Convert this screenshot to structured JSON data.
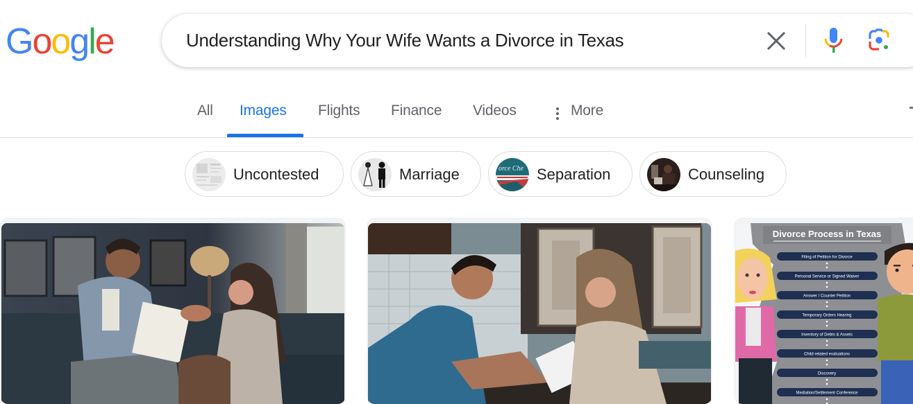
{
  "logo": {
    "text": "Google",
    "letters": [
      {
        "char": "G",
        "color": "#4285f4"
      },
      {
        "char": "o",
        "color": "#ea4335"
      },
      {
        "char": "o",
        "color": "#fbbc05"
      },
      {
        "char": "g",
        "color": "#4285f4"
      },
      {
        "char": "l",
        "color": "#34a853"
      },
      {
        "char": "e",
        "color": "#ea4335"
      }
    ]
  },
  "search": {
    "query": "Understanding Why Your Wife Wants a Divorce in Texas",
    "clear_icon": "close-icon",
    "voice_icon": "microphone-icon",
    "lens_icon": "google-lens-icon"
  },
  "tabs": [
    {
      "label": "All",
      "active": false
    },
    {
      "label": "Images",
      "active": true
    },
    {
      "label": "Flights",
      "active": false
    },
    {
      "label": "Finance",
      "active": false
    },
    {
      "label": "Videos",
      "active": false
    },
    {
      "label": "More",
      "active": false,
      "icon": "more-vertical-icon"
    }
  ],
  "chips": [
    {
      "label": "Uncontested",
      "thumb": "newspaper document thumbnail"
    },
    {
      "label": "Marriage",
      "thumb": "bride and groom silhouette thumbnail"
    },
    {
      "label": "Separation",
      "thumb": "Divorce Check sign thumbnail"
    },
    {
      "label": "Counseling",
      "thumb": "counseling session thumbnail"
    }
  ],
  "results": [
    {
      "alt": "Man holding divorce paper arguing with woman on couch"
    },
    {
      "alt": "Man reading document at kitchen counter with upset woman"
    },
    {
      "alt": "Divorce Process in Texas infographic",
      "title": "Divorce Process in Texas",
      "steps": [
        "Filing of Petition for Divorce",
        "Personal Service or Signed Waiver",
        "Answer / Counter Petition",
        "Temporary Orders Hearing",
        "Inventory of Debts & Assets",
        "Child-related evaluations",
        "Discovery",
        "Mediation/Settlement Conference"
      ]
    }
  ],
  "colors": {
    "accent": "#1a73e8",
    "text_primary": "#202124",
    "text_secondary": "#5f6368",
    "border": "#dadce0"
  }
}
